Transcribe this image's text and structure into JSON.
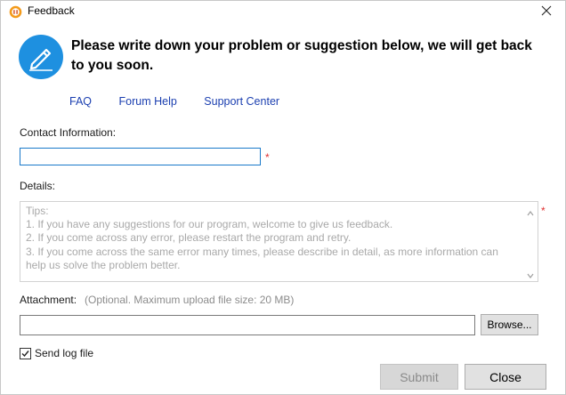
{
  "window": {
    "title": "Feedback",
    "close_glyph": "✕",
    "app_icon": "audio-app-icon"
  },
  "header": {
    "logo_icon": "pencil-feedback-icon",
    "headline": "Please write down your problem or suggestion below, we will get back to you soon."
  },
  "links": [
    {
      "label": "FAQ"
    },
    {
      "label": "Forum Help"
    },
    {
      "label": "Support Center"
    }
  ],
  "contact": {
    "label": "Contact Information:",
    "value": "",
    "required_mark": "*"
  },
  "details": {
    "label": "Details:",
    "required_mark": "*",
    "tips_text": "Tips:\n1. If you have any suggestions for our program, welcome to give us feedback.\n2. If you come across any error, please restart the program and retry.\n3. If you come across the same error many times, please describe in detail, as more information can help us solve the problem better."
  },
  "attachment": {
    "label": "Attachment:",
    "hint": "(Optional. Maximum upload file size: 20 MB)",
    "value": "",
    "browse_label": "Browse..."
  },
  "send_log": {
    "label": "Send log file",
    "checked": true
  },
  "buttons": {
    "submit_label": "Submit",
    "close_label": "Close"
  },
  "colors": {
    "accent": "#1e90e0",
    "link": "#1b3fb0",
    "required": "#e03030",
    "placeholder": "#a9a9a9"
  }
}
